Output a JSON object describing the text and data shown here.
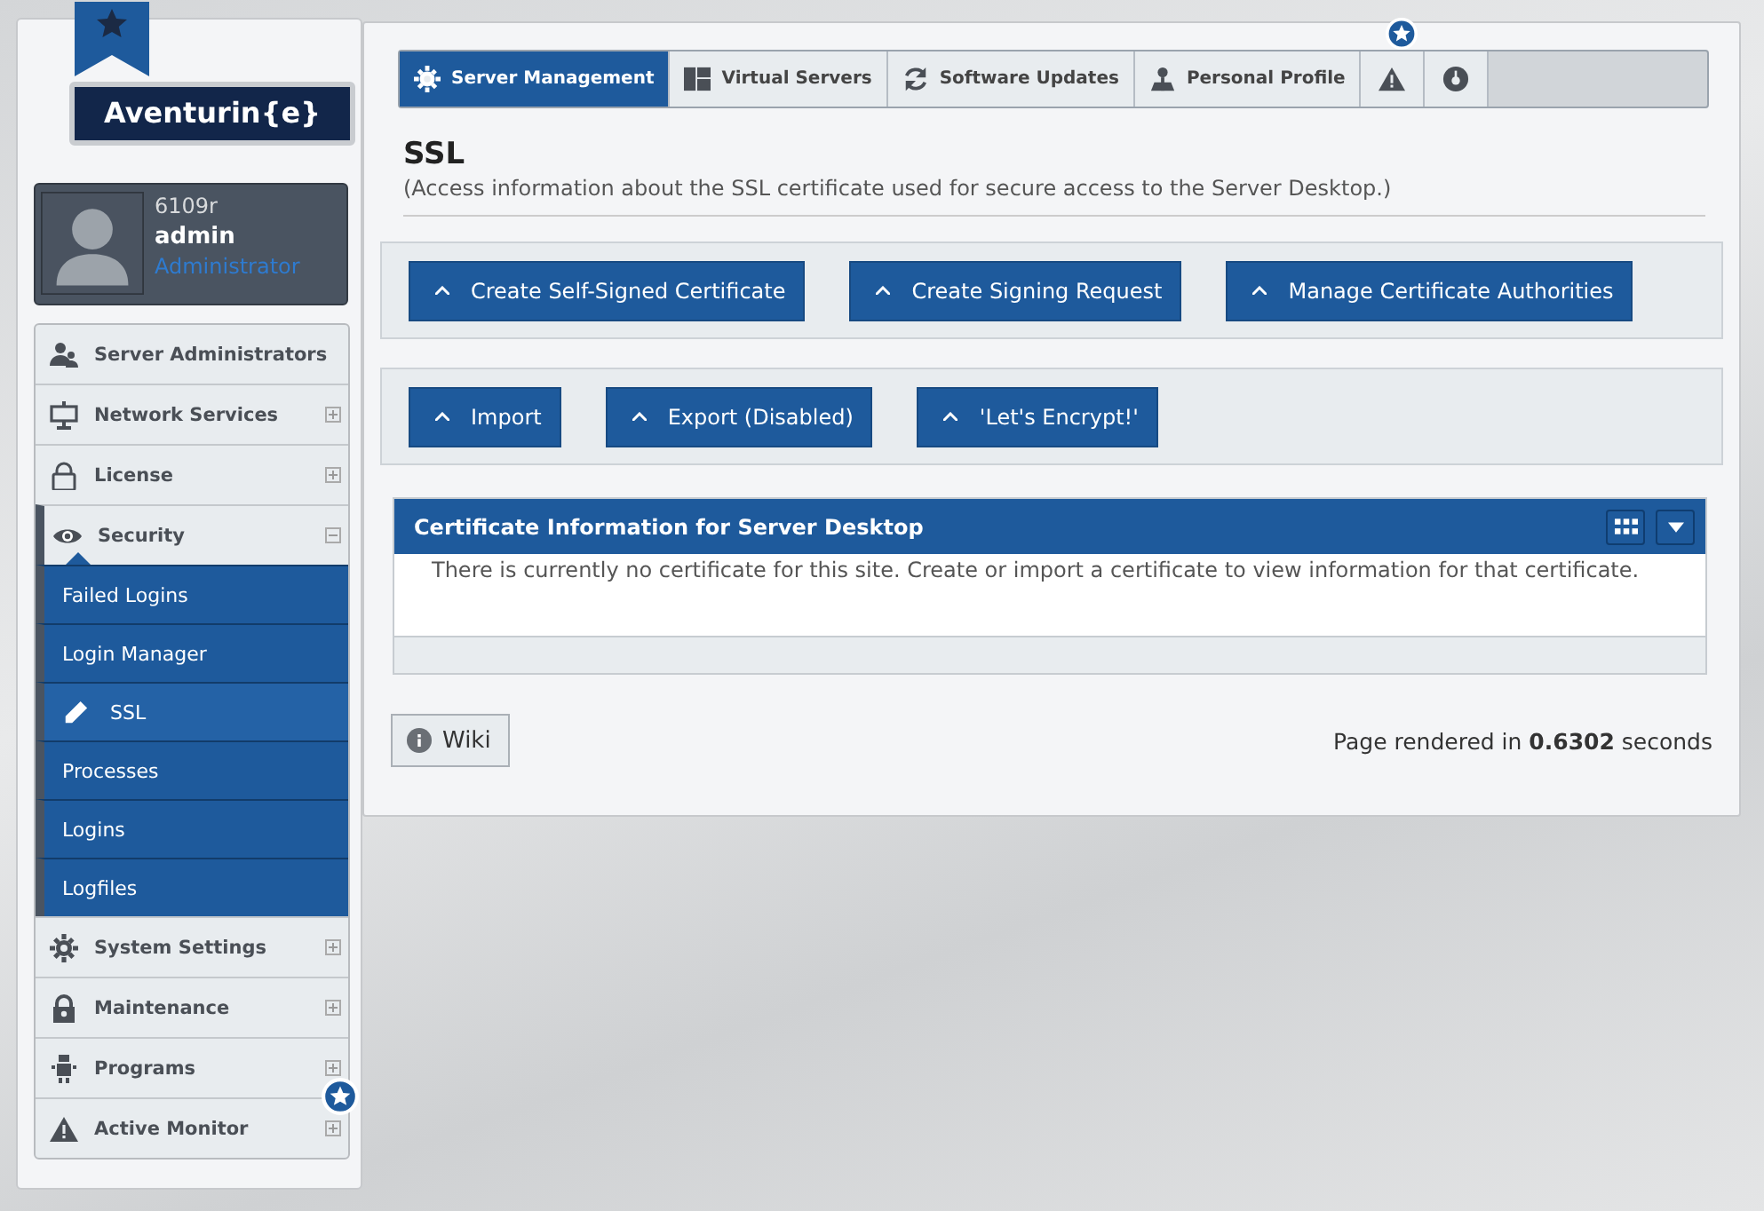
{
  "logo": {
    "text": "Aventurin{e}"
  },
  "user": {
    "host": "6109r",
    "name": "admin",
    "role": "Administrator"
  },
  "nav": [
    {
      "label": "Server Administrators",
      "kind": "users",
      "selected": false,
      "badge": false
    },
    {
      "label": "Network Services",
      "kind": "monitor",
      "expanded": false,
      "selected": false,
      "badge": false
    },
    {
      "label": "License",
      "kind": "lock",
      "expanded": false,
      "selected": false,
      "badge": false
    },
    {
      "label": "Security",
      "kind": "eye",
      "expanded": true,
      "selected": true,
      "badge": false,
      "children": [
        {
          "label": "Failed Logins",
          "selected": false
        },
        {
          "label": "Login Manager",
          "selected": false
        },
        {
          "label": "SSL",
          "selected": true
        },
        {
          "label": "Processes",
          "selected": false
        },
        {
          "label": "Logins",
          "selected": false
        },
        {
          "label": "Logfiles",
          "selected": false
        }
      ]
    },
    {
      "label": "System Settings",
      "kind": "gear",
      "expanded": false,
      "selected": false,
      "badge": false
    },
    {
      "label": "Maintenance",
      "kind": "padlock",
      "expanded": false,
      "selected": false,
      "badge": false
    },
    {
      "label": "Programs",
      "kind": "robot",
      "expanded": false,
      "selected": false,
      "badge": false
    },
    {
      "label": "Active Monitor",
      "kind": "warning",
      "expanded": false,
      "selected": false,
      "badge": true
    }
  ],
  "tabs": [
    {
      "label": "Server Management",
      "kind": "gear",
      "selected": true,
      "badge": false
    },
    {
      "label": "Virtual Servers",
      "kind": "layout",
      "selected": false,
      "badge": false
    },
    {
      "label": "Software Updates",
      "kind": "refresh",
      "selected": false,
      "badge": false
    },
    {
      "label": "Personal Profile",
      "kind": "person",
      "selected": false,
      "badge": false
    },
    {
      "kind": "warning",
      "selected": false,
      "badge": true
    },
    {
      "kind": "gauge",
      "selected": false,
      "badge": false
    }
  ],
  "page": {
    "title": "SSL",
    "subtitle": "(Access information about the SSL certificate used for secure access to the Server Desktop.)"
  },
  "button_rows": [
    [
      "Create Self-Signed Certificate",
      "Create Signing Request",
      "Manage Certificate Authorities"
    ],
    [
      "Import",
      "Export (Disabled)",
      "'Let's Encrypt!'"
    ]
  ],
  "panel": {
    "title": "Certificate Information for Server Desktop",
    "message": "There is currently no certificate for this site. Create or import a certificate to view information for that certificate."
  },
  "wiki": "Wiki",
  "footer": "Page rendered in **0.6302** seconds"
}
